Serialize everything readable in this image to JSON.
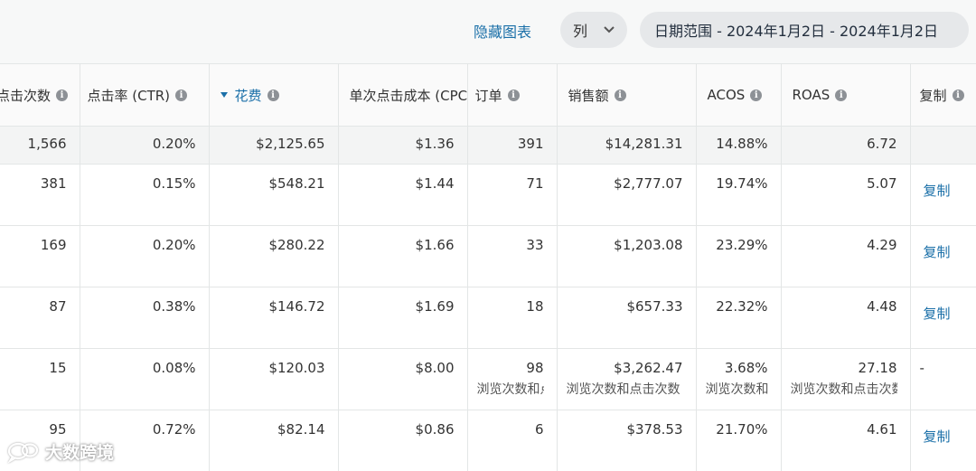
{
  "toolbar": {
    "hide_chart": "隐藏图表",
    "columns_label": "列",
    "date_range": "日期范围 - 2024年1月2日 - 2024年1月2日"
  },
  "columns": [
    {
      "label": "点击次数",
      "info": true
    },
    {
      "label": "点击率 (CTR)",
      "info": true
    },
    {
      "label": "花费",
      "info": true,
      "sorted": true
    },
    {
      "label": "单次点击成本 (CPC",
      "info": false
    },
    {
      "label": "订单",
      "info": true
    },
    {
      "label": "销售额",
      "info": true
    },
    {
      "label": "ACOS",
      "info": true
    },
    {
      "label": "ROAS",
      "info": true
    },
    {
      "label": "复制",
      "info": true
    }
  ],
  "totals": [
    "1,566",
    "0.20%",
    "$2,125.65",
    "$1.36",
    "391",
    "$14,281.31",
    "14.88%",
    "6.72",
    ""
  ],
  "rows": [
    {
      "cells": [
        "381",
        "0.15%",
        "$548.21",
        "$1.44",
        "71",
        "$2,777.07",
        "19.74%",
        "5.07"
      ],
      "copy": "复制"
    },
    {
      "cells": [
        "169",
        "0.20%",
        "$280.22",
        "$1.66",
        "33",
        "$1,203.08",
        "23.29%",
        "4.29"
      ],
      "copy": "复制"
    },
    {
      "cells": [
        "87",
        "0.38%",
        "$146.72",
        "$1.69",
        "18",
        "$657.33",
        "22.32%",
        "4.48"
      ],
      "copy": "复制"
    },
    {
      "cells": [
        "15",
        "0.08%",
        "$120.03",
        "$8.00",
        "98",
        "$3,262.47",
        "3.68%",
        "27.18"
      ],
      "copy": "-",
      "subs": [
        "浏览次数和点击次数",
        "浏览次数和点击次数",
        "浏览次数和点击次数",
        "浏览次数和点击次数"
      ]
    },
    {
      "cells": [
        "95",
        "0.72%",
        "$82.14",
        "$0.86",
        "6",
        "$378.53",
        "21.70%",
        "4.61"
      ],
      "copy": "复制"
    }
  ],
  "watermark": "大数跨境"
}
